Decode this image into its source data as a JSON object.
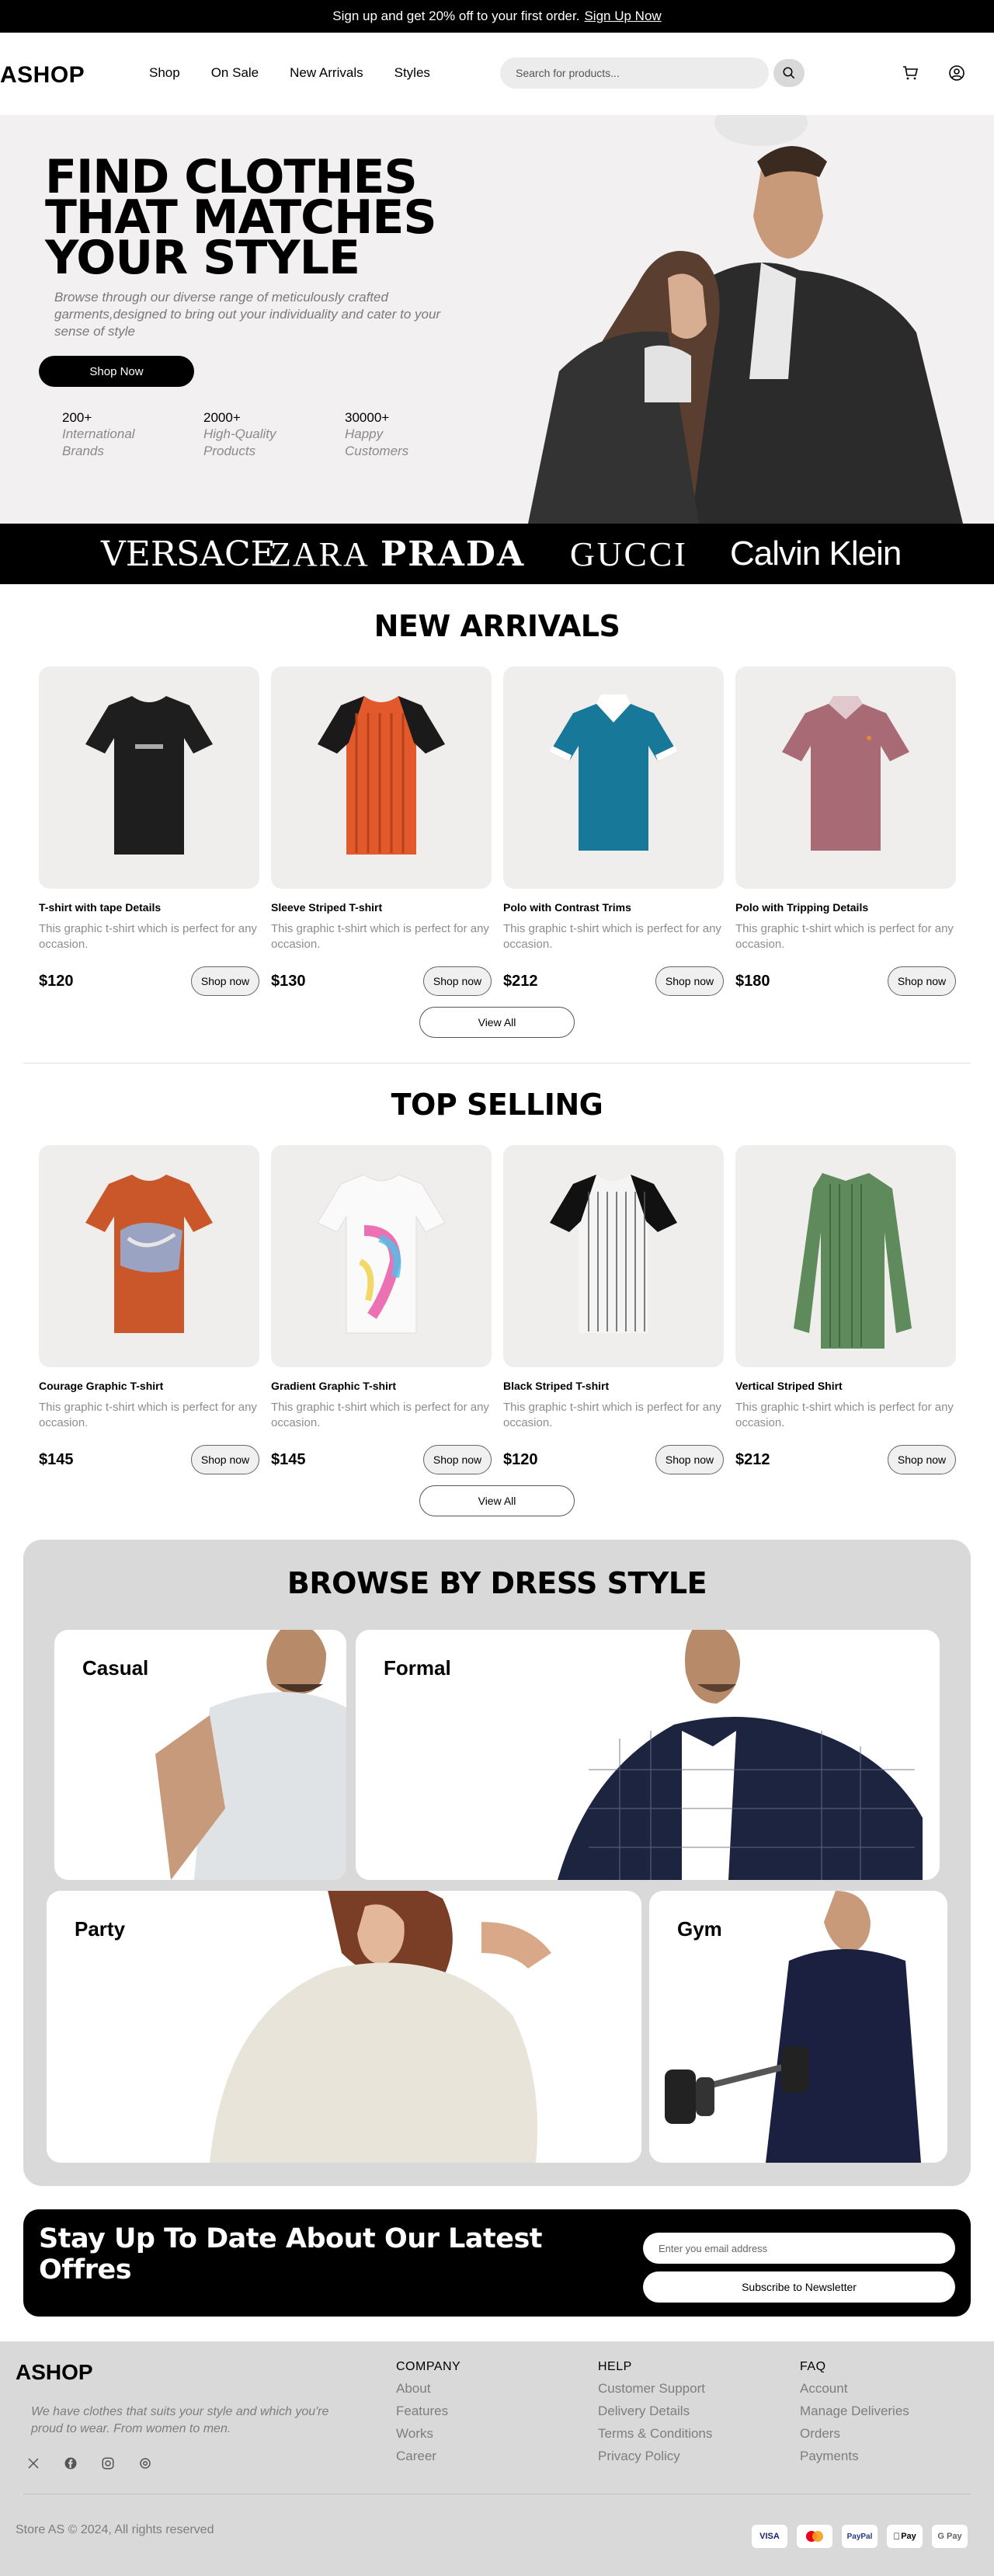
{
  "banner": {
    "text": "Sign up and get 20% off to your first order.",
    "link": "Sign Up Now"
  },
  "header": {
    "logo": "ASHOP",
    "nav": [
      "Shop",
      "On Sale",
      "New Arrivals",
      "Styles"
    ],
    "search_placeholder": "Search for products..."
  },
  "hero": {
    "title_lines": [
      "FIND CLOTHES",
      "THAT MATCHES",
      "YOUR STYLE"
    ],
    "subtitle": "Browse through our diverse range of meticulously crafted garments,designed to bring out your individuality and cater to your sense of style",
    "button": "Shop Now",
    "stats": [
      {
        "num": "200+",
        "label": "International Brands"
      },
      {
        "num": "2000+",
        "label": "High-Quality Products"
      },
      {
        "num": "30000+",
        "label": "Happy Customers"
      }
    ]
  },
  "brands": [
    "VERSACE",
    "ZARA",
    "PRADA",
    "GUCCI",
    "Calvin Klein"
  ],
  "new_arrivals": {
    "title": "NEW ARRIVALS",
    "view_all": "View All",
    "items": [
      {
        "name": "T-shirt with tape Details",
        "desc": "This graphic t-shirt which is perfect for any occasion.",
        "price": "$120",
        "button": "Shop now"
      },
      {
        "name": "Sleeve Striped T-shirt",
        "desc": "This graphic t-shirt which is perfect for any occasion.",
        "price": "$130",
        "button": "Shop now"
      },
      {
        "name": "Polo with Contrast Trims",
        "desc": "This graphic t-shirt which is perfect for any occasion.",
        "price": "$212",
        "button": "Shop now"
      },
      {
        "name": "Polo with Tripping Details",
        "desc": "This graphic t-shirt which is perfect for any occasion.",
        "price": "$180",
        "button": "Shop now"
      }
    ]
  },
  "top_selling": {
    "title": "TOP SELLING",
    "view_all": "View All",
    "items": [
      {
        "name": "Courage Graphic T-shirt",
        "desc": "This graphic t-shirt which is perfect for any occasion.",
        "price": "$145",
        "button": "Shop now"
      },
      {
        "name": "Gradient Graphic T-shirt",
        "desc": "This graphic t-shirt which is perfect for any occasion.",
        "price": "$145",
        "button": "Shop now"
      },
      {
        "name": "Black Striped T-shirt",
        "desc": "This graphic t-shirt which is perfect for any occasion.",
        "price": "$120",
        "button": "Shop now"
      },
      {
        "name": "Vertical Striped Shirt",
        "desc": "This graphic t-shirt which is perfect for any occasion.",
        "price": "$212",
        "button": "Shop now"
      }
    ]
  },
  "browse": {
    "title": "BROWSE BY DRESS STYLE",
    "styles": [
      "Casual",
      "Formal",
      "Party",
      "Gym"
    ]
  },
  "newsletter": {
    "title": "Stay Up To Date About Our Latest Offres",
    "placeholder": "Enter you email address",
    "button": "Subscribe to Newsletter"
  },
  "footer": {
    "logo": "ASHOP",
    "tagline": "We have clothes that suits your style and which you're proud to wear. From women to men.",
    "columns": [
      {
        "heading": "COMPANY",
        "items": [
          "About",
          "Features",
          "Works",
          "Career"
        ]
      },
      {
        "heading": "HELP",
        "items": [
          "Customer Support",
          "Delivery Details",
          "Terms & Conditions",
          "Privacy Policy"
        ]
      },
      {
        "heading": "FAQ",
        "items": [
          "Account",
          "Manage Deliveries",
          "Orders",
          "Payments"
        ]
      }
    ],
    "copyright": "Store AS © 2024, All rights reserved",
    "payments": [
      "VISA",
      "mastercard-icon",
      "PayPal",
      "Pay",
      "G Pay"
    ],
    "social_icons": [
      "x-icon",
      "facebook-icon",
      "instagram-icon",
      "threads-icon"
    ]
  }
}
